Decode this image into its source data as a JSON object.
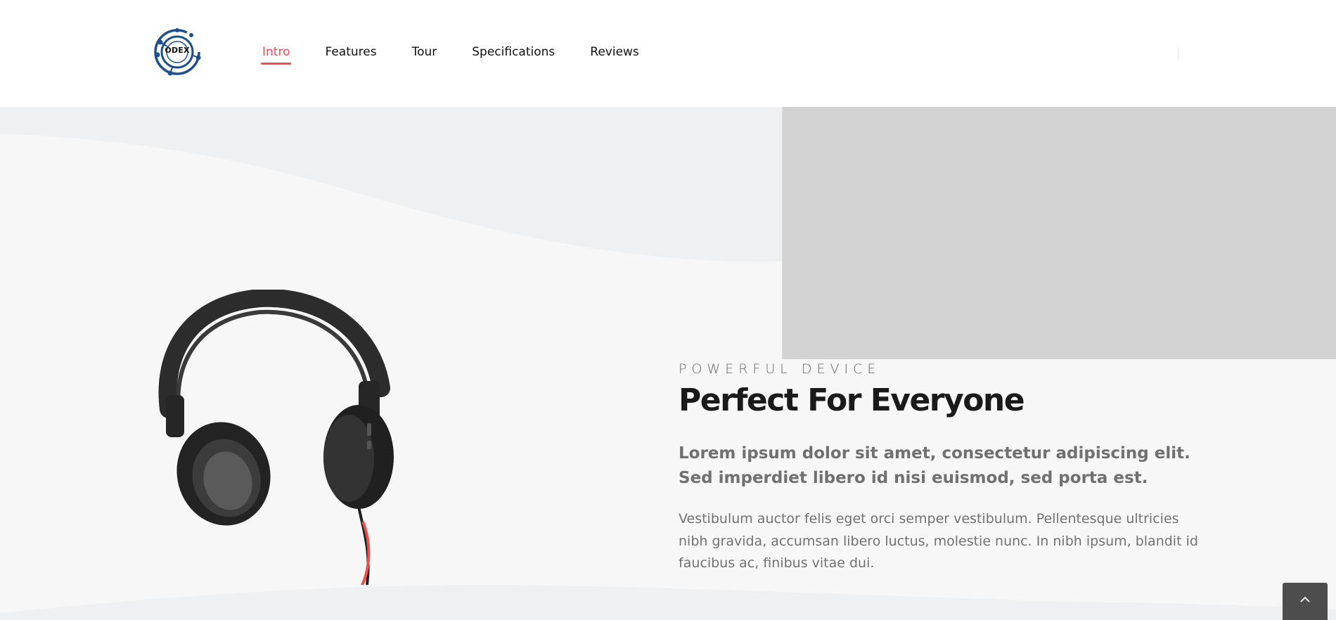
{
  "brand": {
    "logo_text": "ODEX",
    "logo_color": "#1f4e8c"
  },
  "nav": {
    "items": [
      {
        "label": "Intro",
        "active": true
      },
      {
        "label": "Features",
        "active": false
      },
      {
        "label": "Tour",
        "active": false
      },
      {
        "label": "Specifications",
        "active": false
      },
      {
        "label": "Reviews",
        "active": false
      }
    ],
    "active_color": "#ef4d4d"
  },
  "hero": {
    "eyebrow": "POWERFUL DEVICE",
    "headline": "Perfect For Everyone",
    "lead": "Lorem ipsum dolor sit amet, consectetur adipiscing elit. Sed imperdiet libero id nisi euismod, sed porta est.",
    "body": "Vestibulum auctor felis eget orci semper vestibulum. Pellentesque ultricies nibh gravida, accumsan libero luctus, molestie nunc. In nibh ipsum, blandit id faucibus ac, finibus vitae dui.",
    "background_color": "#f7f7f8",
    "wave_color": "#eef0f2",
    "placeholder_color": "#d3d3d3",
    "cable_color": "#ef4d4d"
  },
  "icons": {
    "logo": "circuit-logo-icon",
    "back_to_top": "chevron-up-icon",
    "product": "headphones-image"
  }
}
